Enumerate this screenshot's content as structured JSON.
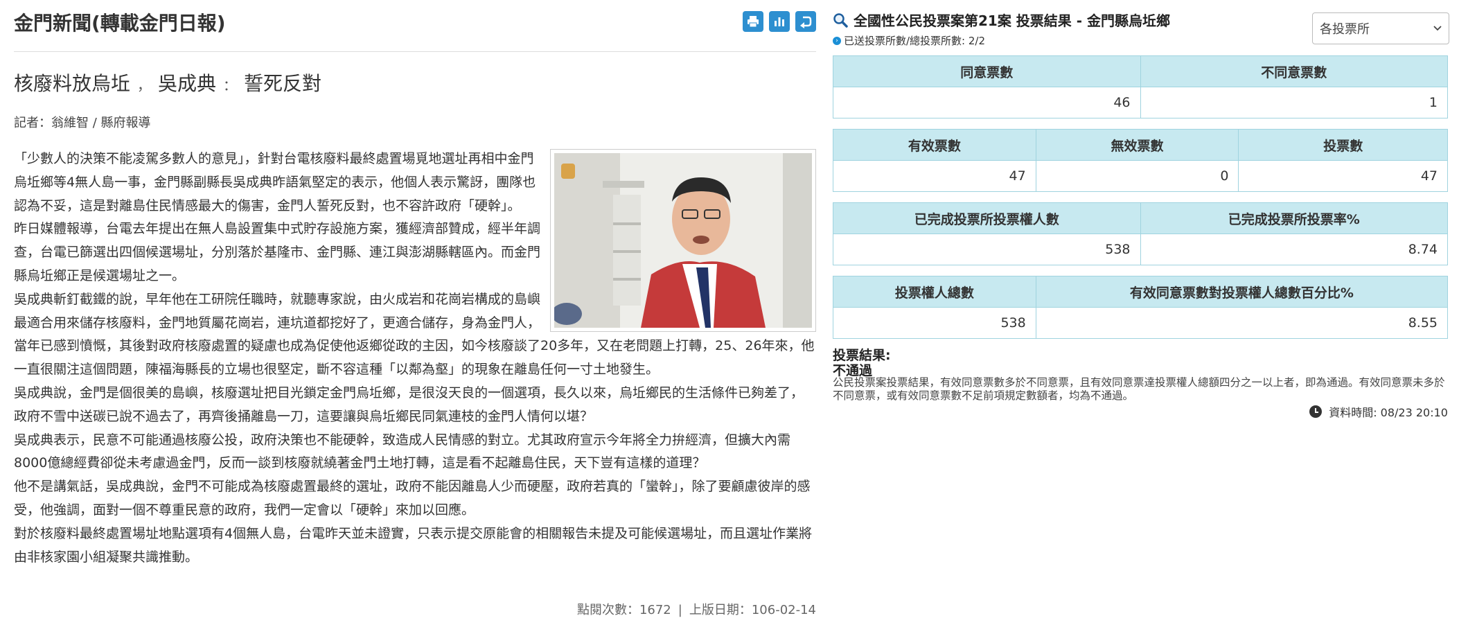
{
  "news": {
    "site_title": "金門新聞(轉載金門日報)",
    "toolbar": {
      "print_icon": "print-icon",
      "chart_icon": "bar-chart-icon",
      "back_icon": "back-arrow-icon"
    },
    "headline": {
      "part1": "核廢料放烏坵",
      "sep1": "，",
      "part2": "吳成典",
      "sep2": "：",
      "part3": "誓死反對"
    },
    "reporter": "記者：翁維智 / 縣府報導",
    "paragraphs": [
      "「少數人的決策不能凌駕多數人的意見」，針對台電核廢料最終處置場覓地選址再相中金門烏坵鄉等4無人島一事，金門縣副縣長吳成典昨語氣堅定的表示，他個人表示驚訝，團隊也認為不妥，這是對離島住民情感最大的傷害，金門人誓死反對，也不容許政府「硬幹」。",
      "昨日媒體報導，台電去年提出在無人島設置集中式貯存設施方案，獲經濟部贊成，經半年調查，台電已篩選出四個候選場址，分別落於基隆市、金門縣、連江與澎湖縣轄區內。而金門縣烏坵鄉正是候選場址之一。",
      "吳成典斬釘截鐵的說，早年他在工研院任職時，就聽專家說，由火成岩和花崗岩構成的島嶼最適合用來儲存核廢料，金門地質屬花崗岩，連坑道都挖好了，更適合儲存，身為金門人，當年已感到憤慨，其後對政府核廢處置的疑慮也成為促使他返鄉從政的主因，如今核廢談了20多年，又在老問題上打轉，25、26年來，他一直很關注這個問題，陳福海縣長的立場也很堅定，斷不容這種「以鄰為壑」的現象在離島任何一寸土地發生。",
      "吳成典說，金門是個很美的島嶼，核廢選址把目光鎖定金門烏坵鄉，是很沒天良的一個選項，長久以來，烏坵鄉民的生活條件已夠差了，政府不雪中送碳已說不過去了，再齊後捅離島一刀，這要讓與烏坵鄉民同氣連枝的金門人情何以堪？",
      "吳成典表示，民意不可能通過核廢公投，政府決策也不能硬幹，致造成人民情感的對立。尤其政府宣示今年將全力拚經濟，但擴大內需8000億總經費卻從未考慮過金門，反而一談到核廢就繞著金門土地打轉，這是看不起離島住民，天下豈有這樣的道理？",
      "他不是講氣話，吳成典說，金門不可能成為核廢處置最終的選址，政府不能因離島人少而硬壓，政府若真的「蠻幹」，除了要顧慮彼岸的感受，他強調，面對一個不尊重民意的政府，我們一定會以「硬幹」來加以回應。",
      "對於核廢料最終處置場址地點選項有4個無人島，台電昨天並未證實，只表示提交原能會的相關報告未提及可能候選場址，而且選址作業將由非核家園小組凝聚共識推動。"
    ],
    "footer": {
      "views_label": "點閱次數：",
      "views": "1672",
      "divider": "|",
      "date_label": "上版日期：",
      "date": "106-02-14"
    }
  },
  "referendum": {
    "title": "全國性公民投票案第21案 投票結果 - 金門縣烏坵鄉",
    "subtitle": "已送投票所數/總投票所數: 2/2",
    "station_select": "各投票所",
    "table1": {
      "headers": [
        "同意票數",
        "不同意票數"
      ],
      "values": [
        "46",
        "1"
      ]
    },
    "table2": {
      "headers": [
        "有效票數",
        "無效票數",
        "投票數"
      ],
      "values": [
        "47",
        "0",
        "47"
      ]
    },
    "table3": {
      "headers": [
        "已完成投票所投票權人數",
        "已完成投票所投票率%"
      ],
      "values": [
        "538",
        "8.74"
      ]
    },
    "table4": {
      "headers": [
        "投票權人總數",
        "有效同意票數對投票權人總數百分比%"
      ],
      "values": [
        "538",
        "8.55"
      ]
    },
    "result_label": "投票結果:",
    "result_value": "不通過",
    "result_note": "公民投票案投票結果，有效同意票數多於不同意票，且有效同意票達投票權人總額四分之一以上者，即為通過。有效同意票未多於不同意票，或有效同意票數不足前項規定數額者，均為不通過。",
    "update_time": "資料時間: 08/23 20:10",
    "colors": {
      "header_bg": "#c7e9f0",
      "border": "#9fd3df",
      "toolbar_blue": "#2d8fd0"
    }
  }
}
